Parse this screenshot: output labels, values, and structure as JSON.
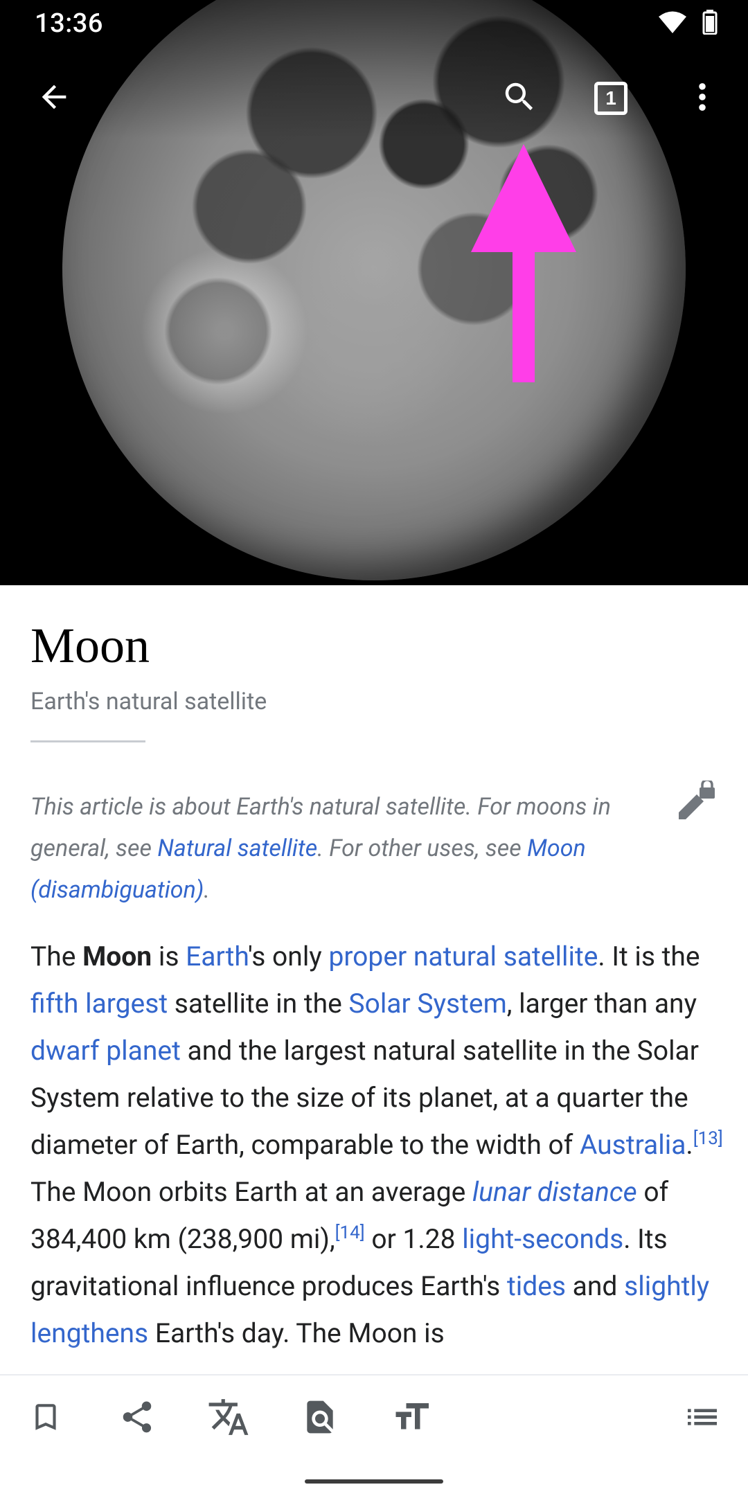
{
  "status": {
    "time": "13:36"
  },
  "toolbar": {
    "tab_count": "1"
  },
  "article": {
    "title": "Moon",
    "description": "Earth's natural satellite",
    "hatnote": {
      "part1": "This article is about Earth's natural satellite. For moons in general, see ",
      "link1": "Natural satellite",
      "part2": ". For other uses, see ",
      "link2": "Moon (disambiguation)",
      "part3": "."
    },
    "paragraph": {
      "s1": "The ",
      "bold": "Moon",
      "s2": " is ",
      "l_earth": "Earth",
      "s3": "'s only ",
      "l_pns": "proper natural satellite",
      "s4": ". It is the ",
      "l_fifth": "fifth largest",
      "s5": " satellite in the ",
      "l_solar": "Solar System",
      "s6": ", larger than any ",
      "l_dwarf": "dwarf planet",
      "s7": " and the largest natural satellite in the Solar System relative to the size of its planet, at a quarter the diameter of Earth, comparable to the width of ",
      "l_australia": "Australia",
      "s8": ".",
      "ref13": "[13]",
      "s9": " The Moon orbits Earth at an average ",
      "l_lunar": "lunar distance",
      "s10": " of 384,400 km (238,900 mi),",
      "ref14": "[14]",
      "s11": " or 1.28 ",
      "l_ls": "light-seconds",
      "s12": ". Its gravitational influence produces Earth's ",
      "l_tides": "tides",
      "s13": " and ",
      "l_slightly": "slightly lengthens",
      "s14": " Earth's day. The Moon is"
    }
  },
  "colors": {
    "link": "#3366cc",
    "arrow": "#ff3ee8",
    "muted": "#72777d"
  },
  "icons": {
    "back": "arrow-left-icon",
    "search": "search-icon",
    "tabs": "tabs-icon",
    "more": "more-vert-icon",
    "save": "bookmark-icon",
    "share": "share-icon",
    "language": "translate-icon",
    "find": "find-in-page-icon",
    "theme": "text-size-icon",
    "contents": "contents-list-icon"
  }
}
